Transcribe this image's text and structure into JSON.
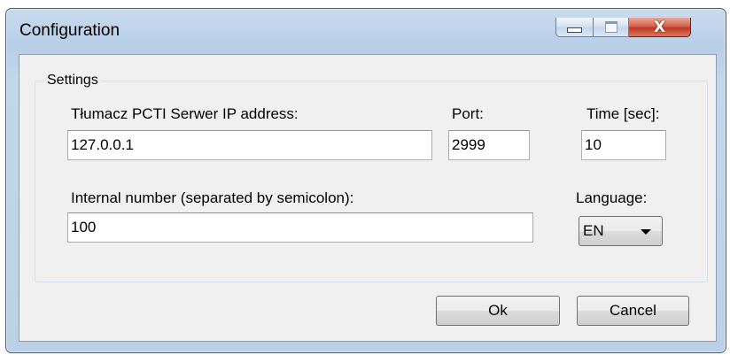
{
  "window": {
    "title": "Configuration"
  },
  "caption_buttons": {
    "minimize_icon": "minimize-icon",
    "maximize_icon": "maximize-icon",
    "close_icon": "close-icon",
    "close_glyph": "X"
  },
  "settings": {
    "group_label": "Settings",
    "server_ip": {
      "label": "Tłumacz PCTI Serwer IP address:",
      "value": "127.0.0.1"
    },
    "port": {
      "label": "Port:",
      "value": "2999"
    },
    "time": {
      "label": "Time [sec]:",
      "value": "10"
    },
    "internal_number": {
      "label": "Internal number (separated by semicolon):",
      "value": "100"
    },
    "language": {
      "label": "Language:",
      "selected": "EN"
    }
  },
  "buttons": {
    "ok": "Ok",
    "cancel": "Cancel"
  }
}
